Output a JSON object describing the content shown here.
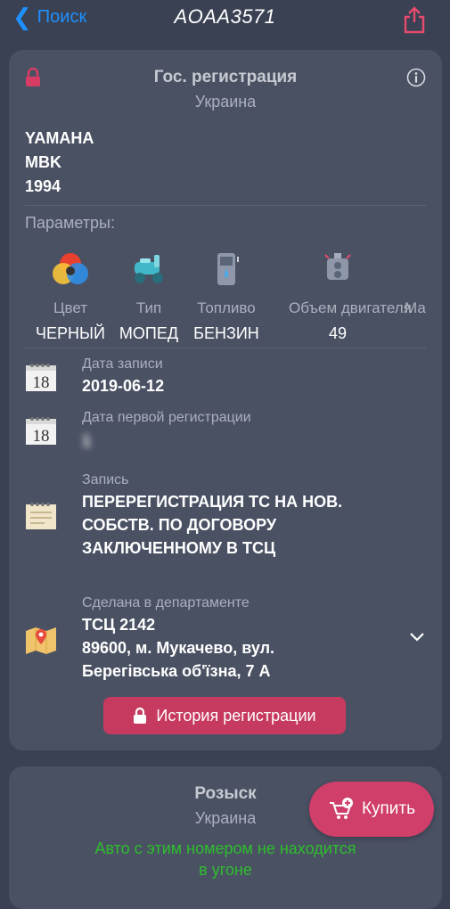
{
  "nav": {
    "back_label": "Поиск",
    "title": "AOAA3571"
  },
  "registration": {
    "title": "Гос. регистрация",
    "country": "Украина",
    "vehicle": {
      "brand": "YAMAHA",
      "model": "MBK",
      "year": "1994"
    },
    "params_title": "Параметры:",
    "params": [
      {
        "label": "Цвет",
        "value": "ЧЕРНЫЙ",
        "icon": "color-wheel-icon"
      },
      {
        "label": "Тип",
        "value": "МОПЕД",
        "icon": "scooter-icon"
      },
      {
        "label": "Топливо",
        "value": "БЕНЗИН",
        "icon": "fuel-pump-icon"
      },
      {
        "label": "Объем двигателя",
        "value": "49",
        "icon": "engine-icon"
      },
      {
        "label": "Ма",
        "value": "",
        "icon": ""
      }
    ],
    "record_date_label": "Дата записи",
    "record_date": "2019-06-12",
    "first_reg_label": "Дата первой регистрации",
    "first_reg_value": "1"
  },
  "record": {
    "label": "Запись",
    "value_lines": [
      "ПЕРЕРЕГИСТРАЦИЯ ТС НА НОВ.",
      "СОБСТВ. ПО ДОГОВОРУ",
      "ЗАКЛЮЧЕННОМУ В ТСЦ"
    ]
  },
  "department": {
    "label": "Сделана в департаменте",
    "lines": [
      "ТСЦ 2142",
      "89600, м. Мукачево, вул.",
      "Берегівська об'їзна, 7 А"
    ]
  },
  "history_button": "История регистрации",
  "wanted": {
    "title": "Розыск",
    "country": "Украина",
    "status_lines": [
      "Авто с этим номером не находится",
      "в угоне"
    ]
  },
  "buy_button": "Купить",
  "calendar_day": "18",
  "colors": {
    "accent": "#c73a5f",
    "link": "#1e90ff",
    "ok": "#2ebd2e"
  }
}
